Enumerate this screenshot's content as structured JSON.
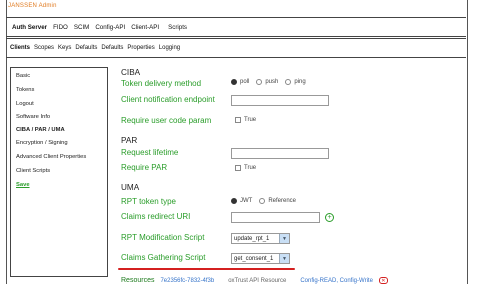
{
  "app": {
    "brand": "JANSSEN Admin"
  },
  "topnav": {
    "items": [
      "Auth Server",
      "FIDO",
      "SCIM",
      "Config-API",
      "Client-API",
      "Scripts"
    ]
  },
  "subnav": {
    "items": [
      "Clients",
      "Scopes",
      "Keys",
      "Defaults",
      "Defaults",
      "Properties",
      "Logging"
    ]
  },
  "sidebar": {
    "items": [
      "Basic",
      "Tokens",
      "Logout",
      "Software Info",
      "CIBA / PAR / UMA",
      "Encryption / Signing",
      "Advanced Client Properties",
      "Client Scripts",
      "Save"
    ]
  },
  "ciba": {
    "heading": "CIBA",
    "token_delivery_label": "Token delivery method",
    "token_delivery_options": [
      "poll",
      "push",
      "ping"
    ],
    "token_delivery_selected": "poll",
    "notification_endpoint_label": "Client notification endpoint",
    "notification_endpoint_value": "",
    "require_user_code_label": "Require user code param",
    "require_user_code_checkbox_label": "True",
    "require_user_code_checked": false
  },
  "par": {
    "heading": "PAR",
    "request_lifetime_label": "Request lifetime",
    "request_lifetime_value": "",
    "require_par_label": "Require PAR",
    "require_par_checkbox_label": "True",
    "require_par_checked": false
  },
  "uma": {
    "heading": "UMA",
    "rpt_token_type_label": "RPT token type",
    "rpt_token_type_options": [
      "JWT",
      "Reference"
    ],
    "rpt_token_type_selected": "JWT",
    "claims_redirect_label": "Claims redirect URI",
    "claims_redirect_value": "",
    "add_icon": "plus-icon",
    "rpt_modification_label": "RPT Modification Script",
    "rpt_modification_value": "update_rpt_1",
    "claims_gathering_label": "Claims Gathering Script",
    "claims_gathering_value": "get_consent_1"
  },
  "resources": {
    "label": "Resources",
    "id": "7e2356fc-7832-4f3b",
    "name": "oxTrust API Resource",
    "scopes": "Config-READ, Config-Write",
    "remove_icon": "x-icon"
  },
  "colors": {
    "label_green": "#2a9d2a",
    "brand_orange": "#e07a1f",
    "highlight_red": "#d42020",
    "link_blue": "#3573c9"
  }
}
